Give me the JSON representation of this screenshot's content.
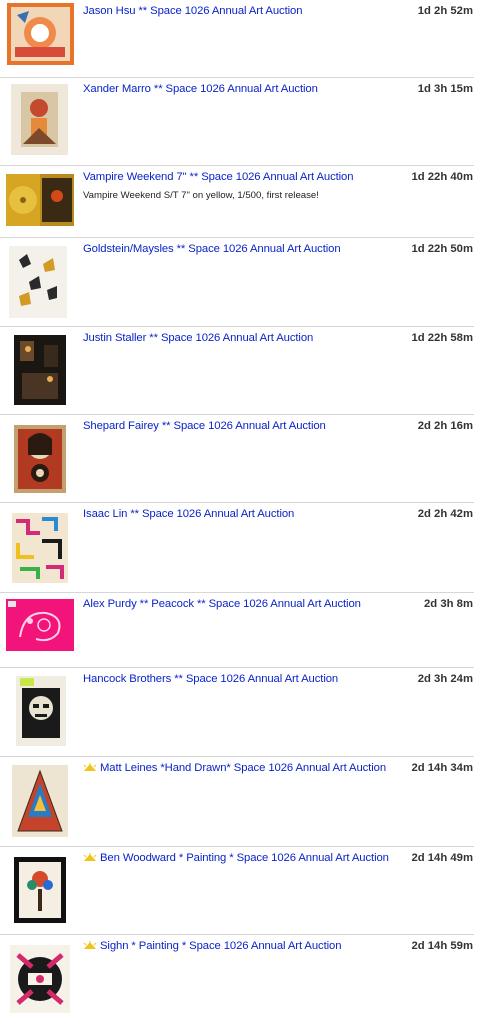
{
  "listings": [
    {
      "title": "Jason Hsu ** Space 1026 Annual Art Auction",
      "time_left": "1d 2h 52m",
      "thumb_icon": "artwork-thumbnail",
      "featured": false
    },
    {
      "title": "Xander Marro ** Space 1026 Annual Art Auction",
      "time_left": "1d 3h 15m",
      "thumb_icon": "artwork-thumbnail",
      "featured": false
    },
    {
      "title": "Vampire Weekend 7\" ** Space 1026 Annual Art Auction",
      "subtitle": "Vampire Weekend S/T 7\" on yellow, 1/500, first release!",
      "time_left": "1d 22h 40m",
      "thumb_icon": "vinyl-record-thumbnail",
      "featured": false
    },
    {
      "title": "Goldstein/Maysles ** Space 1026 Annual Art Auction",
      "time_left": "1d 22h 50m",
      "thumb_icon": "artwork-thumbnail",
      "featured": false
    },
    {
      "title": "Justin Staller ** Space 1026 Annual Art Auction",
      "time_left": "1d 22h 58m",
      "thumb_icon": "photo-thumbnail",
      "featured": false
    },
    {
      "title": "Shepard Fairey ** Space 1026 Annual Art Auction",
      "time_left": "2d 2h 16m",
      "thumb_icon": "poster-thumbnail",
      "featured": false
    },
    {
      "title": "Isaac Lin ** Space 1026 Annual Art Auction",
      "time_left": "2d 2h 42m",
      "thumb_icon": "pattern-artwork-thumbnail",
      "featured": false
    },
    {
      "title": "Alex Purdy ** Peacock ** Space 1026 Annual Art Auction",
      "time_left": "2d 3h 8m",
      "thumb_icon": "peacock-print-thumbnail",
      "featured": false
    },
    {
      "title": "Hancock Brothers ** Space 1026 Annual Art Auction",
      "time_left": "2d 3h 24m",
      "thumb_icon": "woodcut-print-thumbnail",
      "featured": false
    },
    {
      "title": "Matt Leines *Hand Drawn* Space 1026 Annual Art Auction",
      "time_left": "2d 14h 34m",
      "thumb_icon": "triangle-drawing-thumbnail",
      "featured": true
    },
    {
      "title": "Ben Woodward * Painting * Space 1026 Annual Art Auction",
      "time_left": "2d 14h 49m",
      "thumb_icon": "framed-painting-thumbnail",
      "featured": true
    },
    {
      "title": "Sighn * Painting * Space 1026 Annual Art Auction",
      "time_left": "2d 14h 59m",
      "thumb_icon": "painting-thumbnail",
      "featured": true
    }
  ]
}
